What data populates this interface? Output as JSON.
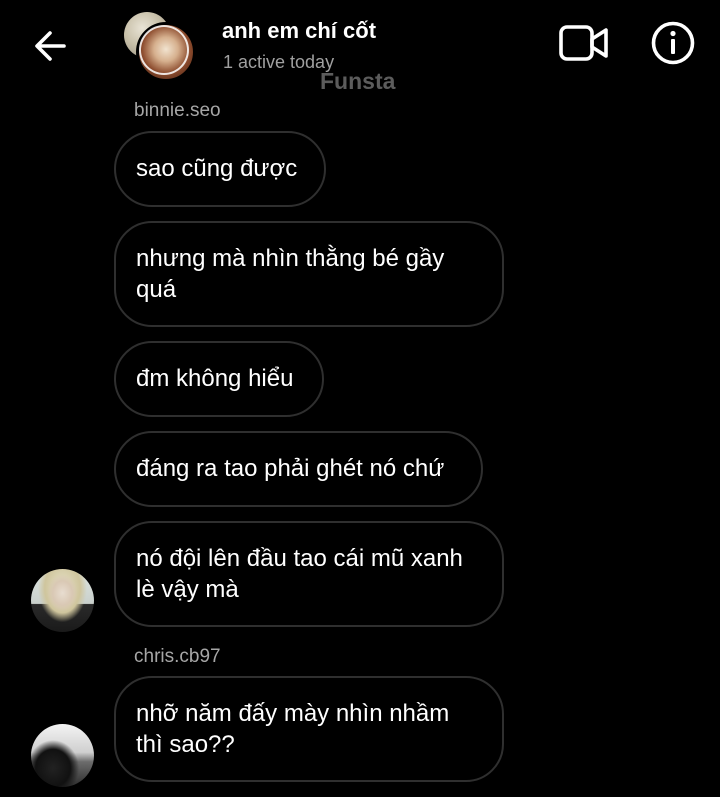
{
  "header": {
    "title": "anh em chí cốt",
    "status": "1 active today",
    "watermark": "Funsta",
    "back_icon": "arrow-left-icon",
    "video_icon": "video-camera-icon",
    "info_icon": "info-icon"
  },
  "messages": {
    "group1": {
      "sender": "binnie.seo",
      "bubbles": [
        {
          "lines": [
            "sao cũng được"
          ]
        },
        {
          "lines": [
            "nhưng mà nhìn thằng bé gầy",
            "quá"
          ]
        },
        {
          "lines": [
            "đm không hiểu"
          ]
        },
        {
          "lines": [
            "đáng ra tao phải ghét nó chứ"
          ]
        },
        {
          "lines": [
            "nó đội lên đầu tao cái mũ xanh",
            "lè vậy mà"
          ]
        }
      ]
    },
    "group2": {
      "sender": "chris.cb97",
      "bubbles": [
        {
          "lines": [
            "nhỡ năm đấy mày nhìn nhầm",
            "thì sao??"
          ]
        }
      ]
    }
  },
  "colors": {
    "background": "#000000",
    "bubble_border": "#2f2f2f",
    "secondary_text": "#a6a6a6"
  }
}
